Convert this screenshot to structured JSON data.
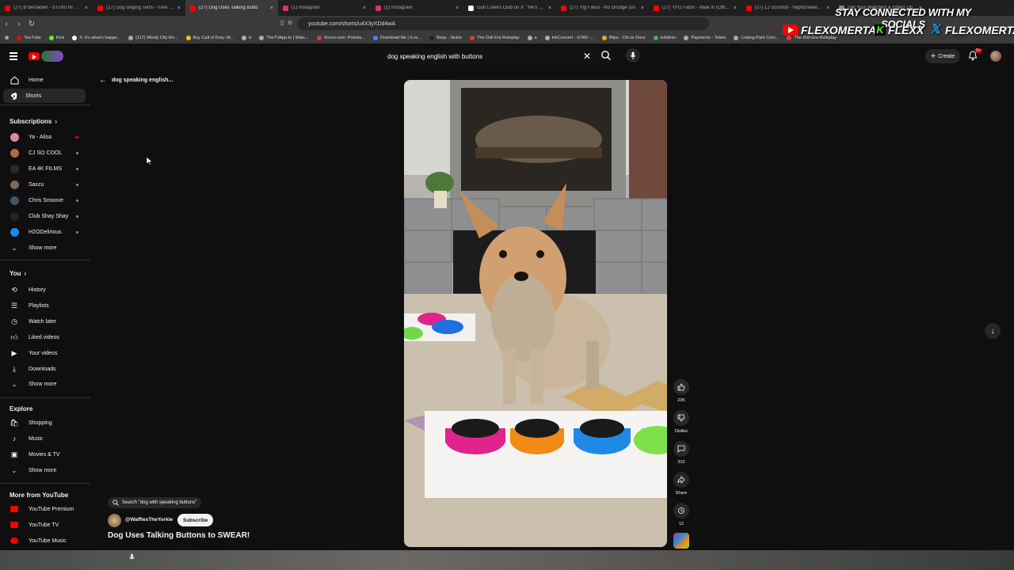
{
  "browser": {
    "tabs": [
      {
        "title": "(27) B Benladen - STUNTIN' LIKE M",
        "color": "#ff0000"
      },
      {
        "title": "(27) Dog singing Tems - Free Mirro",
        "color": "#ff0000"
      },
      {
        "title": "(27) Dog Uses Talking Butto",
        "color": "#ff0000",
        "active": true
      },
      {
        "title": "(1) Instagram",
        "color": "#e1306c"
      },
      {
        "title": "(1) Instagram",
        "color": "#e1306c"
      },
      {
        "title": "Gun Lovers Club on X: \"He's runni",
        "color": "#ffffff"
      },
      {
        "title": "(27) Yfg Fatso - No Grudge (un",
        "color": "#ff0000"
      },
      {
        "title": "(27) YFG Fatso - Walk In (Official M",
        "color": "#ff0000"
      },
      {
        "title": "(27) LJ Scooni8 - Nightcrawler (Of",
        "color": "#ff0000"
      },
      {
        "title": "Get Your Watchlist & Filters Up",
        "color": "#888888"
      }
    ],
    "url": "youtube.com/shorts/u4X3yXDd4wA",
    "bookmarks": [
      {
        "label": "YouTube",
        "color": "#ff0000"
      },
      {
        "label": "Kick",
        "color": "#53fc18"
      },
      {
        "label": "X: It's what's happe...",
        "color": "#ffffff"
      },
      {
        "label": "(117) Windy City Ro...",
        "color": "#aaaaaa"
      },
      {
        "label": "Buy Call of Duty: M...",
        "color": "#f5c518"
      },
      {
        "label": "b",
        "color": "#aaaaaa"
      },
      {
        "label": "TheTVApp.to | Watc...",
        "color": "#aaaaaa"
      },
      {
        "label": "Vicrez.com: Premiu...",
        "color": "#e53935"
      },
      {
        "label": "Download file | iLov...",
        "color": "#4285f4"
      },
      {
        "label": "Shop - Sickio",
        "color": "#222222"
      },
      {
        "label": "The Drill Era Roleplay",
        "color": "#e53935"
      },
      {
        "label": "a",
        "color": "#aaaaaa"
      },
      {
        "label": "InkConvert - GTA5 -...",
        "color": "#aaaaaa"
      },
      {
        "label": "Blips - Cfx.re Docs",
        "color": "#f5a623"
      },
      {
        "label": "txAdmin",
        "color": "#4caf50"
      },
      {
        "label": "Payments - Tebex",
        "color": "#aaaaaa"
      },
      {
        "label": "Linking Park Com...",
        "color": "#aaaaaa"
      },
      {
        "label": "The Drill Era Roleplay",
        "color": "#e53935"
      }
    ]
  },
  "overlay": {
    "title": "STAY CONNECTED WITH MY SOCIALS",
    "socials": [
      {
        "icon": "youtube-icon",
        "handle": "FLEXOMERTA"
      },
      {
        "icon": "kick-icon",
        "handle": "FLEXX"
      },
      {
        "icon": "x-icon",
        "handle": "FLEXOMERTA"
      }
    ]
  },
  "header": {
    "search_query": "dog speaking english with buttons",
    "create_label": "Create",
    "notif_count": "9+"
  },
  "sidebar": {
    "home": "Home",
    "shorts": "Shorts",
    "subscriptions_title": "Subscriptions",
    "subscriptions": [
      {
        "name": "Ya - Alisa",
        "color": "#d88b9a",
        "live": true
      },
      {
        "name": "CJ SO COOL",
        "color": "#b26b4a"
      },
      {
        "name": "EA 4K FILMS",
        "color": "#2b2b2b"
      },
      {
        "name": "Saxzu",
        "color": "#7a6a5a"
      },
      {
        "name": "Chris Smoove",
        "color": "#445566"
      },
      {
        "name": "Club Shay Shay",
        "color": "#222222"
      },
      {
        "name": "H2ODelirious",
        "color": "#1e88e5"
      }
    ],
    "show_more": "Show more",
    "you_title": "You",
    "you_items": [
      "History",
      "Playlists",
      "Watch later",
      "Liked videos",
      "Your videos",
      "Downloads"
    ],
    "explore_title": "Explore",
    "explore_items": [
      "Shopping",
      "Music",
      "Movies & TV"
    ],
    "more_title": "More from YouTube",
    "more_items": [
      "YouTube Premium",
      "YouTube TV",
      "YouTube Music"
    ]
  },
  "short": {
    "back_label": "dog speaking english...",
    "search_chip": "Search \"dog with speaking buttons\"",
    "channel": "@WafflesTheYorkie",
    "subscribe": "Subscribe",
    "title": "Dog Uses Talking Buttons to SWEAR!",
    "likes": "23K",
    "dislike": "Dislike",
    "comments": "310",
    "share": "Share",
    "remix": "12"
  }
}
